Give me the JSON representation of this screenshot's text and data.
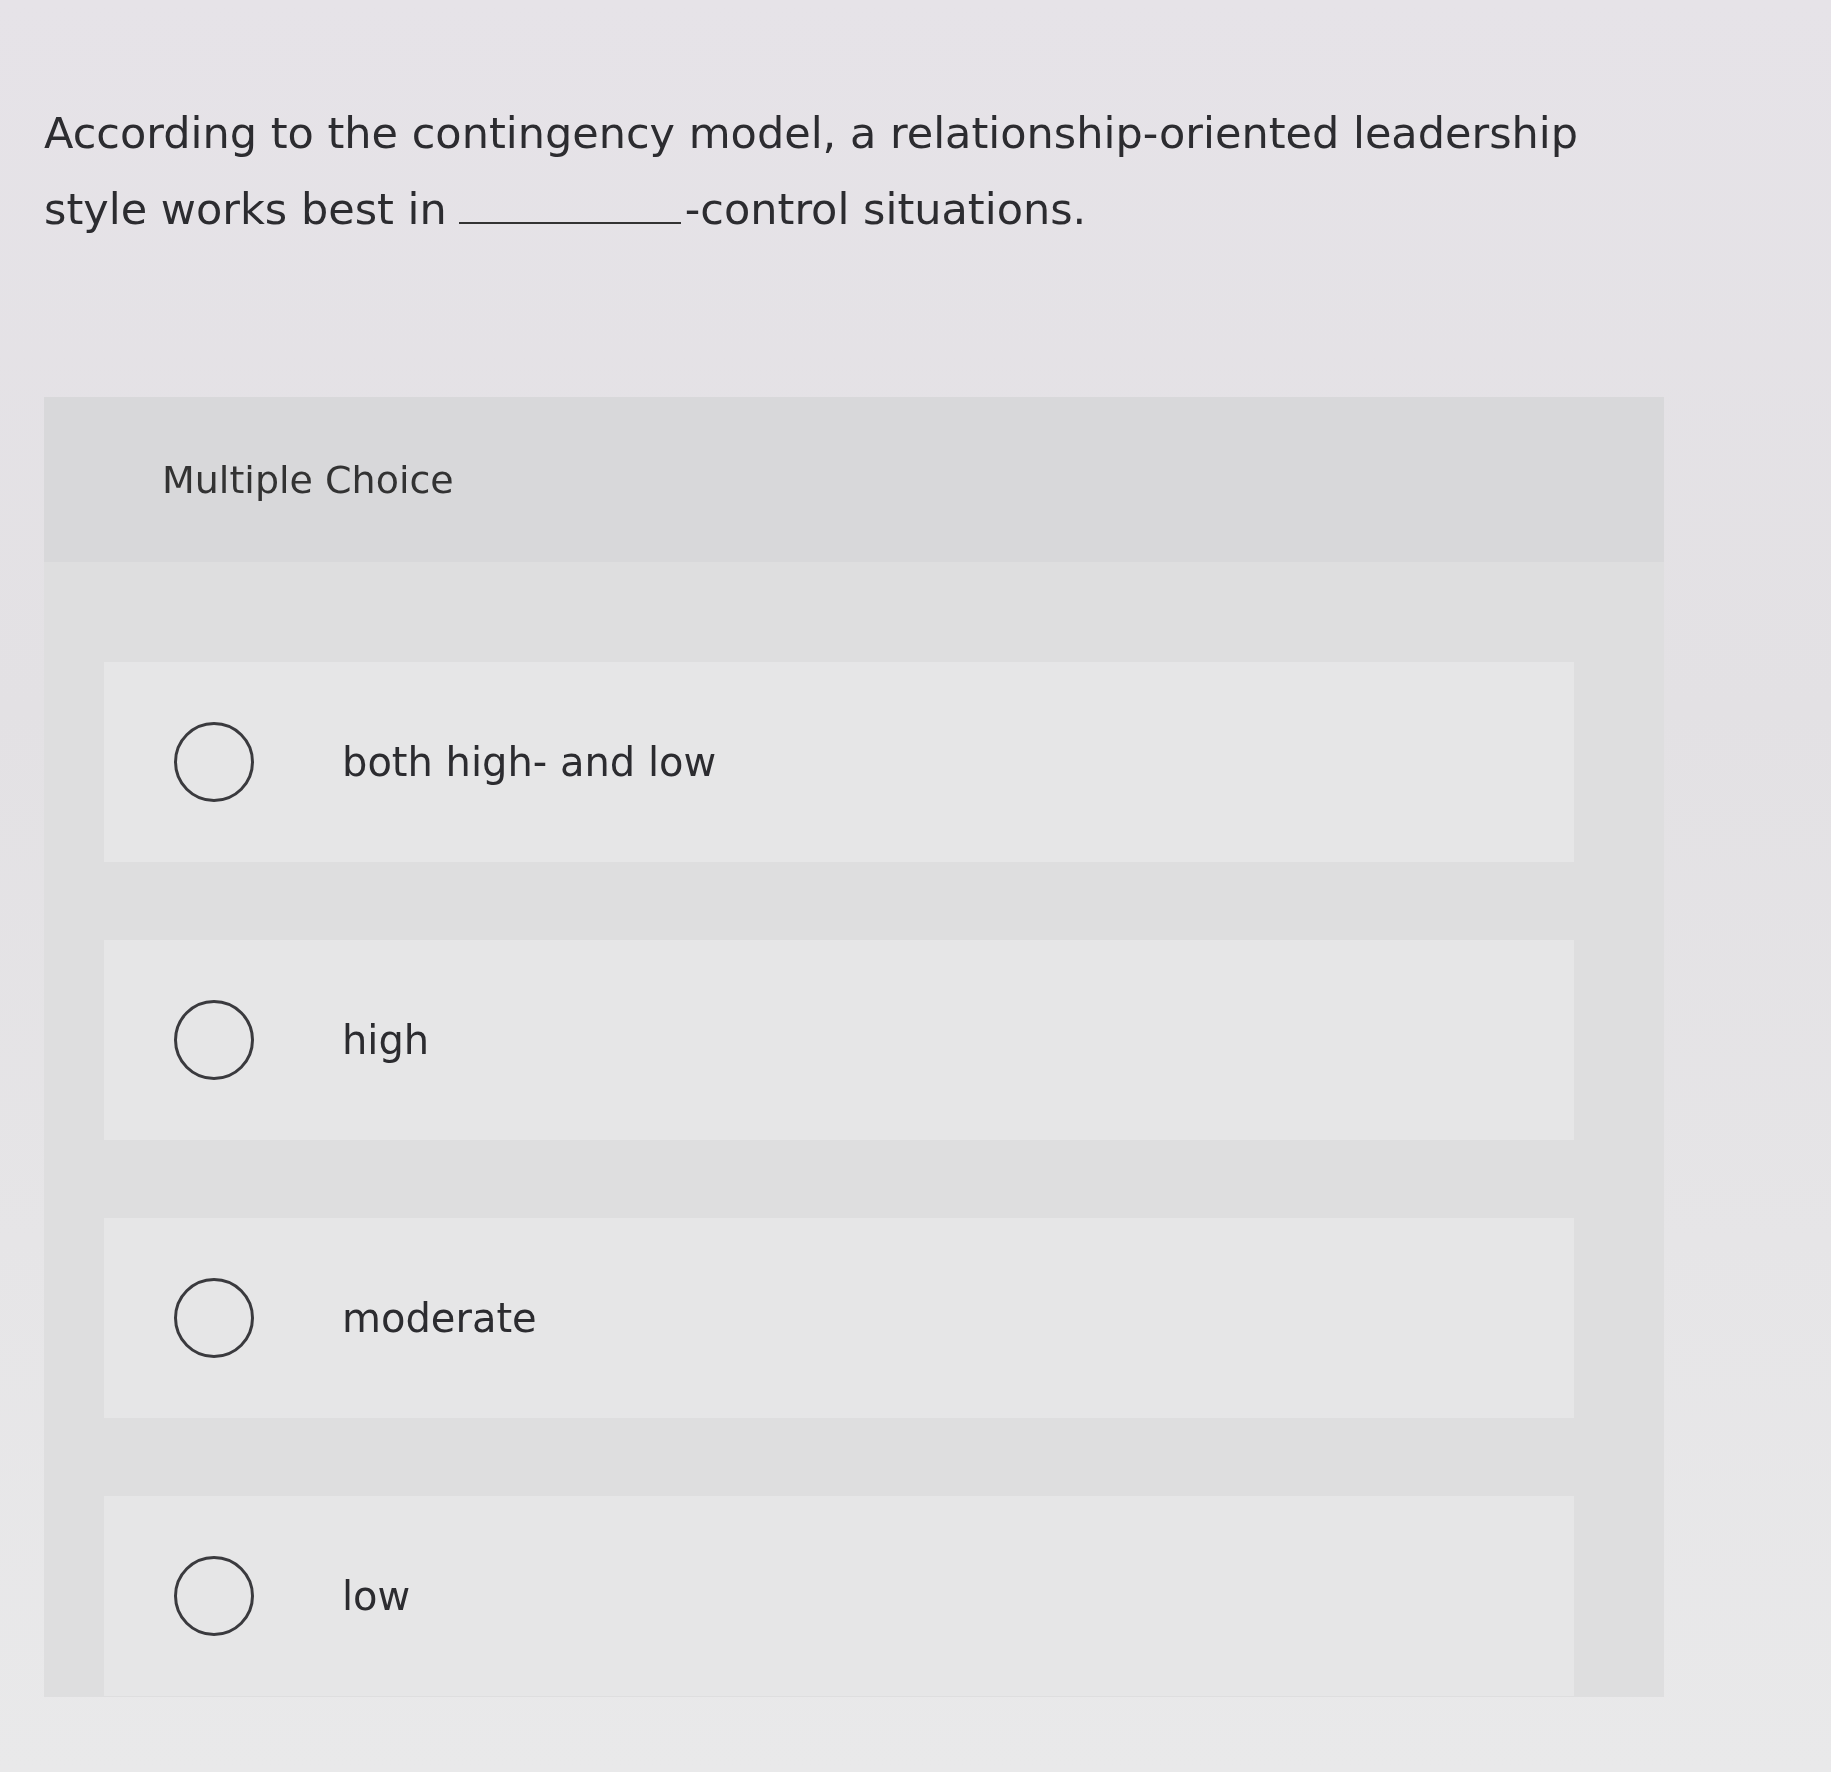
{
  "question": {
    "before": "According to the contingency model, a relationship-oriented leadership style works best in",
    "after": "-control situations."
  },
  "section_label": "Multiple Choice",
  "options": [
    {
      "label": "both high- and low",
      "selected": false
    },
    {
      "label": "high",
      "selected": false
    },
    {
      "label": "moderate",
      "selected": false
    },
    {
      "label": "low",
      "selected": false
    }
  ]
}
